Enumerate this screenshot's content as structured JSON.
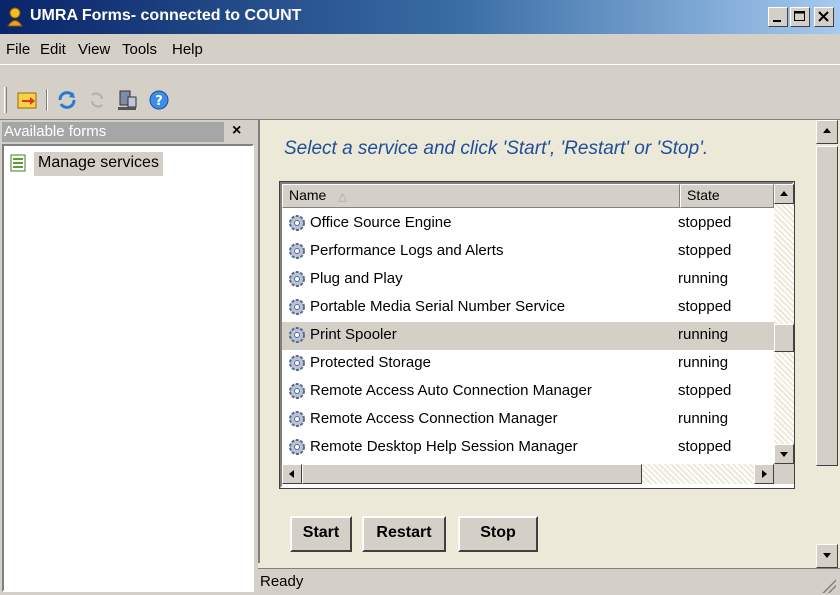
{
  "window": {
    "title": "UMRA Forms- connected to COUNT",
    "controls": [
      "minimize",
      "maximize",
      "close"
    ]
  },
  "menu": [
    "File",
    "Edit",
    "View",
    "Tools",
    "Help"
  ],
  "toolbar": {
    "icons": [
      "open-form-icon",
      "refresh-icon",
      "disconnect-icon",
      "server-icon",
      "help-icon"
    ]
  },
  "left_panel": {
    "header": "Available forms",
    "close_glyph": "×",
    "items": [
      {
        "label": "Manage services",
        "selected": true
      }
    ]
  },
  "main": {
    "instruction": "Select a service and click 'Start', 'Restart' or 'Stop'.",
    "columns": {
      "name": "Name",
      "state": "State"
    },
    "rows": [
      {
        "name": "Office Source Engine",
        "state": "stopped",
        "selected": false
      },
      {
        "name": "Performance Logs and Alerts",
        "state": "stopped",
        "selected": false
      },
      {
        "name": "Plug and Play",
        "state": "running",
        "selected": false
      },
      {
        "name": "Portable Media Serial Number Service",
        "state": "stopped",
        "selected": false
      },
      {
        "name": "Print Spooler",
        "state": "running",
        "selected": true
      },
      {
        "name": "Protected Storage",
        "state": "running",
        "selected": false
      },
      {
        "name": "Remote Access Auto Connection Manager",
        "state": "stopped",
        "selected": false
      },
      {
        "name": "Remote Access Connection Manager",
        "state": "running",
        "selected": false
      },
      {
        "name": "Remote Desktop Help Session Manager",
        "state": "stopped",
        "selected": false
      }
    ],
    "buttons": {
      "start": "Start",
      "restart": "Restart",
      "stop": "Stop"
    }
  },
  "status": {
    "text": "Ready"
  },
  "colors": {
    "instruction_text": "#1f4e9a",
    "title_bar": "#0a246a"
  }
}
